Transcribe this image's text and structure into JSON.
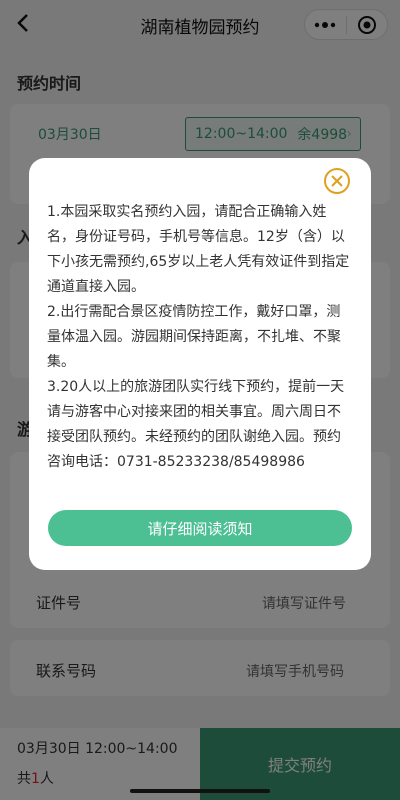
{
  "nav": {
    "title": "湖南植物园预约",
    "back_icon": "chevron-left-icon",
    "more_icon": "more-dots-icon",
    "target_icon": "target-circle-icon"
  },
  "booking_time": {
    "section_title": "预约时间",
    "date": "03月30日",
    "slot_time": "12:00~14:00",
    "slot_remaining": "余4998"
  },
  "partial_labels": {
    "section2": "入",
    "section3": "游"
  },
  "form": {
    "id_label": "证件号",
    "id_placeholder": "请填写证件号",
    "phone_label": "联系号码",
    "phone_placeholder": "请填写手机号码"
  },
  "bottom_bar": {
    "selected": "03月30日 12:00~14:00",
    "count_prefix": "共",
    "count_value": "1",
    "count_suffix": "人",
    "submit_label": "提交预约"
  },
  "modal": {
    "close_icon": "close-circle-icon",
    "notice_lines": [
      "1.本园采取实名预约入园，请配合正确输入姓名，身份证号码，手机号等信息。12岁（含）以下小孩无需预约,65岁以上老人凭有效证件到指定通道直接入园。",
      "2.出行需配合景区疫情防控工作，戴好口罩，测量体温入园。游园期间保持距离，不扎堆、不聚集。",
      "3.20人以上的旅游团队实行线下预约，提前一天请与游客中心对接来团的相关事宜。周六周日不接受团队预约。未经预约的团队谢绝入园。预约咨询电话：0731-85233238/85498986"
    ],
    "button_label": "请仔细阅读须知"
  },
  "colors": {
    "accent": "#3a9a74",
    "button": "#4cbf93",
    "close": "#e0a020"
  }
}
